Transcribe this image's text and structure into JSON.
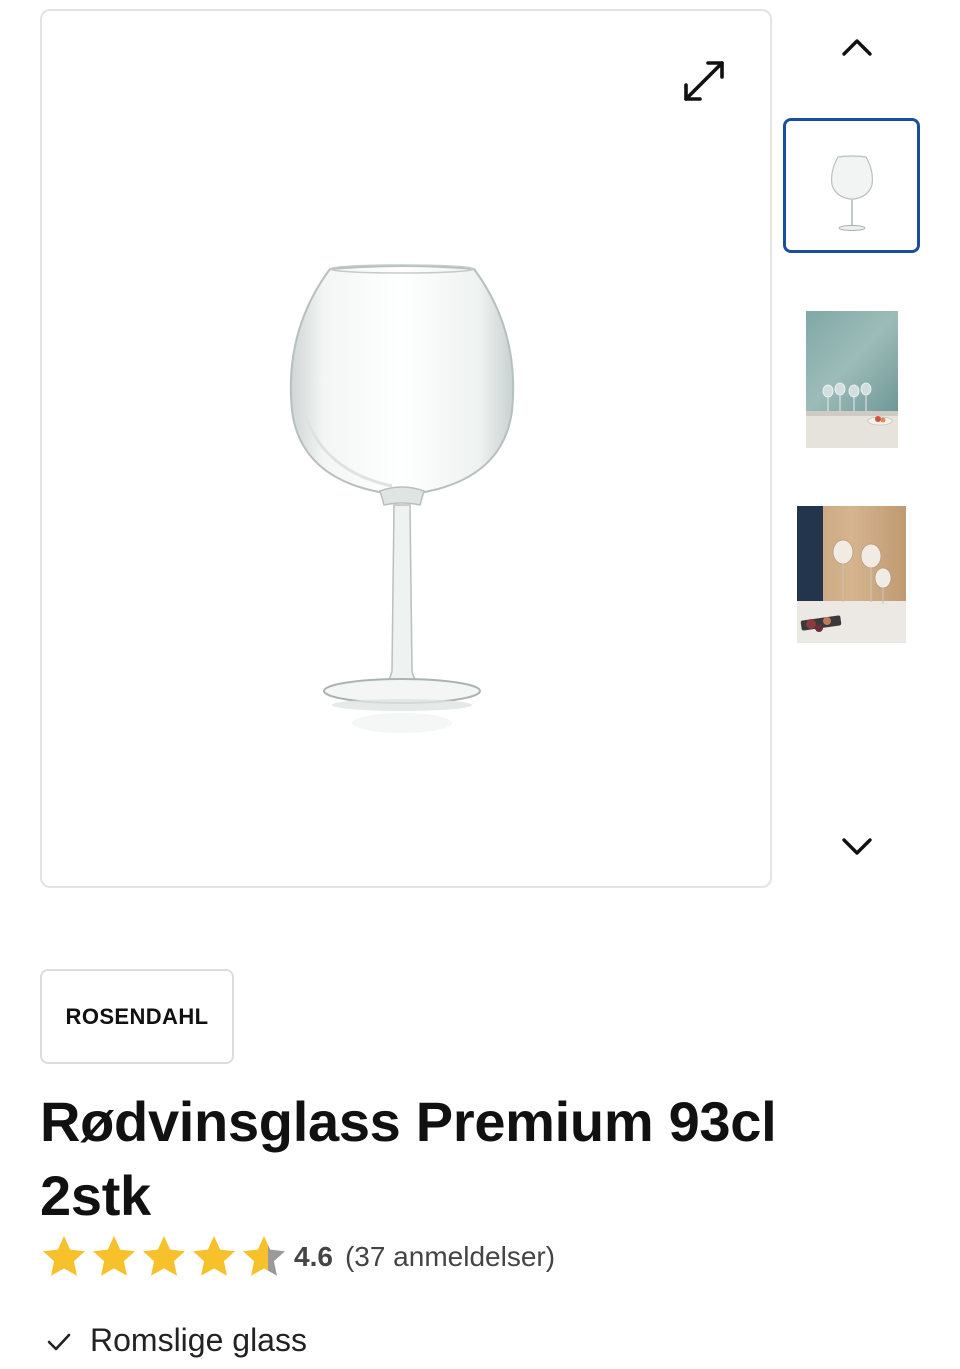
{
  "gallery": {
    "main_image_alt": "Rødvinsglass Premium 93cl 2stk",
    "expand_icon": "expand-icon",
    "nav_up_icon": "chevron-up-icon",
    "nav_down_icon": "chevron-down-icon",
    "thumbnails": [
      {
        "name": "product-glass",
        "selected": true
      },
      {
        "name": "lifestyle-teal-wall",
        "selected": false
      },
      {
        "name": "lifestyle-wood-wall",
        "selected": false
      }
    ]
  },
  "brand": {
    "label": "ROSENDAHL"
  },
  "product": {
    "title": "Rødvinsglass Premium 93cl 2stk"
  },
  "rating": {
    "value": "4.6",
    "value_numeric": 4.6,
    "max": 5,
    "count_text": "(37 anmeldelser)",
    "star_color": "#f7c12b",
    "star_empty_color": "#9a9a9a"
  },
  "features": [
    {
      "icon": "check-icon",
      "text": "Romslige glass"
    }
  ],
  "colors": {
    "selected_thumb_border": "#1a4d9c",
    "frame_border": "#e3e3e3",
    "text": "#111111"
  }
}
